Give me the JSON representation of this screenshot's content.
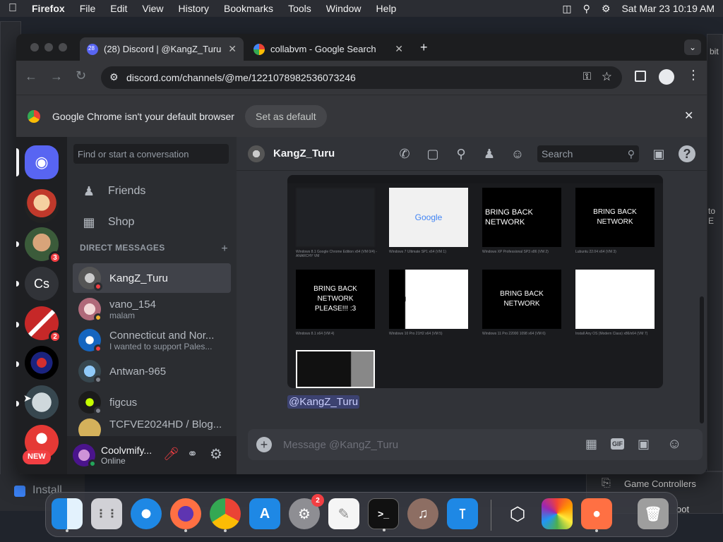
{
  "menubar": {
    "app": "Firefox",
    "items": [
      "File",
      "Edit",
      "View",
      "History",
      "Bookmarks",
      "Tools",
      "Window",
      "Help"
    ],
    "datetime": "Sat Mar 23  10:19 AM"
  },
  "desktop": {
    "install_label": "Install",
    "game_controllers": "Game Controllers",
    "edge_text_1": "bit",
    "edge_text_2": "to E",
    "edge_text_3": "oot"
  },
  "tabs": [
    {
      "title": "(28) Discord | @KangZ_Turu",
      "badge": "28"
    },
    {
      "title": "collabvm - Google Search"
    }
  ],
  "url": "discord.com/channels/@me/1221078982536073246",
  "infobar": {
    "message": "Google Chrome isn't your default browser",
    "button": "Set as default"
  },
  "guilds": [
    {
      "label": "",
      "badge": ""
    },
    {
      "label": "",
      "badge": ""
    },
    {
      "label": "",
      "badge": "3"
    },
    {
      "label": "Cs",
      "badge": ""
    },
    {
      "label": "",
      "badge": "2"
    },
    {
      "label": "",
      "badge": ""
    },
    {
      "label": "",
      "badge": ""
    },
    {
      "label": "",
      "badge": "NEW"
    }
  ],
  "sidebar": {
    "search_placeholder": "Find or start a conversation",
    "friends": "Friends",
    "shop": "Shop",
    "dm_header": "DIRECT MESSAGES",
    "dms": [
      {
        "name": "KangZ_Turu",
        "sub": ""
      },
      {
        "name": "vano_154",
        "sub": "malam"
      },
      {
        "name": "Connecticut and Nor...",
        "sub": "I wanted to support Pales..."
      },
      {
        "name": "Antwan-965",
        "sub": ""
      },
      {
        "name": "figcus",
        "sub": ""
      },
      {
        "name": "TCFVE2024HD / Blog...",
        "sub": ""
      }
    ],
    "user": {
      "name": "Coolvmify...",
      "status": "Online"
    }
  },
  "chat": {
    "header_name": "KangZ_Turu",
    "search_placeholder": "Search",
    "thumbs": [
      {
        "text": "",
        "caption": "Windows 8.1 Google Chrome Edition x64 (VM 0/4) - ANARCHY VM"
      },
      {
        "text": "Google",
        "caption": "Windows 7 Ultimate SP1 x64 (VM 1)"
      },
      {
        "text": "BRING BACK NETWORK",
        "caption": "Windows XP Professional SP3 x86 (VM 2)"
      },
      {
        "text": "BRING BACK NETWORK",
        "caption": "Lubuntu 22.04 x64 (VM 3)"
      },
      {
        "text": "BRING BACK NETWORK PLEASE!!! :3",
        "caption": "Windows 8.1 x64 (VM 4)"
      },
      {
        "text": "bring",
        "caption": "Windows 10 Pro 21H2 x64 (VM 5)"
      },
      {
        "text": "BRING BACK NETWORK",
        "caption": "Windows 11 Pro 22000 1098 x64 (VM 6)"
      },
      {
        "text": "",
        "caption": "Install Any OS (Modern Class) x86/x64 (VM 7)"
      },
      {
        "text": "",
        "caption": ""
      }
    ],
    "mention": "@KangZ_Turu",
    "composer_placeholder": "Message @KangZ_Turu"
  },
  "dock": {
    "settings_badge": "2"
  },
  "colors": {
    "discord_blurple": "#5865f2",
    "danger": "#f23f43",
    "online": "#23a55a"
  }
}
